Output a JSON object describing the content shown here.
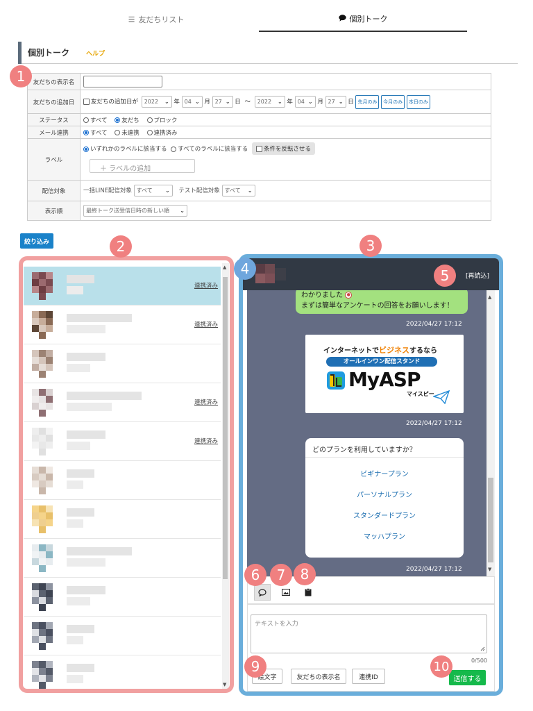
{
  "tabs": [
    {
      "label": "友だちリスト",
      "icon": "list-icon",
      "active": false
    },
    {
      "label": "個別トーク",
      "icon": "speech-bubble-icon",
      "active": true
    }
  ],
  "page_header": {
    "title": "個別トーク",
    "help": "ヘルプ"
  },
  "filter": {
    "display_name": {
      "label": "友だちの表示名",
      "value": ""
    },
    "added_date": {
      "label": "友だちの追加日",
      "checkbox_label": "友だちの追加日が",
      "from": {
        "year": "2022",
        "month": "04",
        "day": "27"
      },
      "to": {
        "year": "2022",
        "month": "04",
        "day": "27"
      },
      "year_unit": "年",
      "month_unit": "月",
      "day_unit": "日",
      "range_sep": "～",
      "buttons": [
        "先月のみ",
        "今月のみ",
        "本日のみ"
      ]
    },
    "status": {
      "label": "ステータス",
      "options": [
        "すべて",
        "友だち",
        "ブロック"
      ],
      "selected": "友だち"
    },
    "mail_link": {
      "label": "メール連携",
      "options": [
        "すべて",
        "未連携",
        "連携済み"
      ],
      "selected": "すべて"
    },
    "labels": {
      "label": "ラベル",
      "options": [
        "いずれかのラベルに該当する",
        "すべてのラベルに該当する"
      ],
      "selected": "いずれかのラベルに該当する",
      "invert_label": "条件を反転させる",
      "add_placeholder": "＋ ラベルの追加"
    },
    "delivery_target": {
      "label": "配信対象",
      "bulk_label": "一括LINE配信対象",
      "bulk_value": "すべて",
      "test_label": "テスト配信対象",
      "test_value": "すべて"
    },
    "display_order": {
      "label": "表示順",
      "value": "最終トーク送受信日時の新しい順"
    },
    "submit": "絞り込み"
  },
  "badges": [
    "1",
    "2",
    "3",
    "4",
    "5",
    "6",
    "7",
    "8",
    "9",
    "10"
  ],
  "friend_list": [
    {
      "linked": "連携済み",
      "selected": true
    },
    {
      "linked": "連携済み",
      "selected": false
    },
    {
      "linked": "",
      "selected": false
    },
    {
      "linked": "連携済み",
      "selected": false
    },
    {
      "linked": "連携済み",
      "selected": false
    },
    {
      "linked": "",
      "selected": false
    },
    {
      "linked": "",
      "selected": false
    },
    {
      "linked": "",
      "selected": false
    },
    {
      "linked": "",
      "selected": false
    },
    {
      "linked": "",
      "selected": false
    },
    {
      "linked": "",
      "selected": false
    }
  ],
  "chat": {
    "reload": "[再読込]",
    "messages": [
      {
        "line1": "わかりました",
        "line2": "まずは簡単なアンケートの回答をお願いします！",
        "time": "2022/04/27 17:12"
      },
      {
        "banner_line1_a": "インターネットで",
        "banner_line1_b": "ビジネス",
        "banner_line1_c": "するなら",
        "banner_line2": "オールインワン配信スタンド",
        "banner_brand": "MyASP",
        "banner_kana": "マイスピー",
        "time": "2022/04/27 17:12"
      },
      {
        "question": "どのプランを利用していますか？",
        "choices": [
          "ビギナープラン",
          "パーソナルプラン",
          "スタンダードプラン",
          "マッハプラン"
        ],
        "time": "2022/04/27 17:12"
      }
    ]
  },
  "composer": {
    "placeholder": "テキストを入力",
    "counter": "0/500",
    "insert_buttons": [
      "絵文字",
      "友だちの表示名",
      "連携ID"
    ],
    "send": "送信する"
  },
  "colors": {
    "accent_blue": "#1a82c9",
    "send_green": "#15b94b",
    "badge_pink": "#f08080",
    "badge_blue": "#6fa6dd"
  }
}
